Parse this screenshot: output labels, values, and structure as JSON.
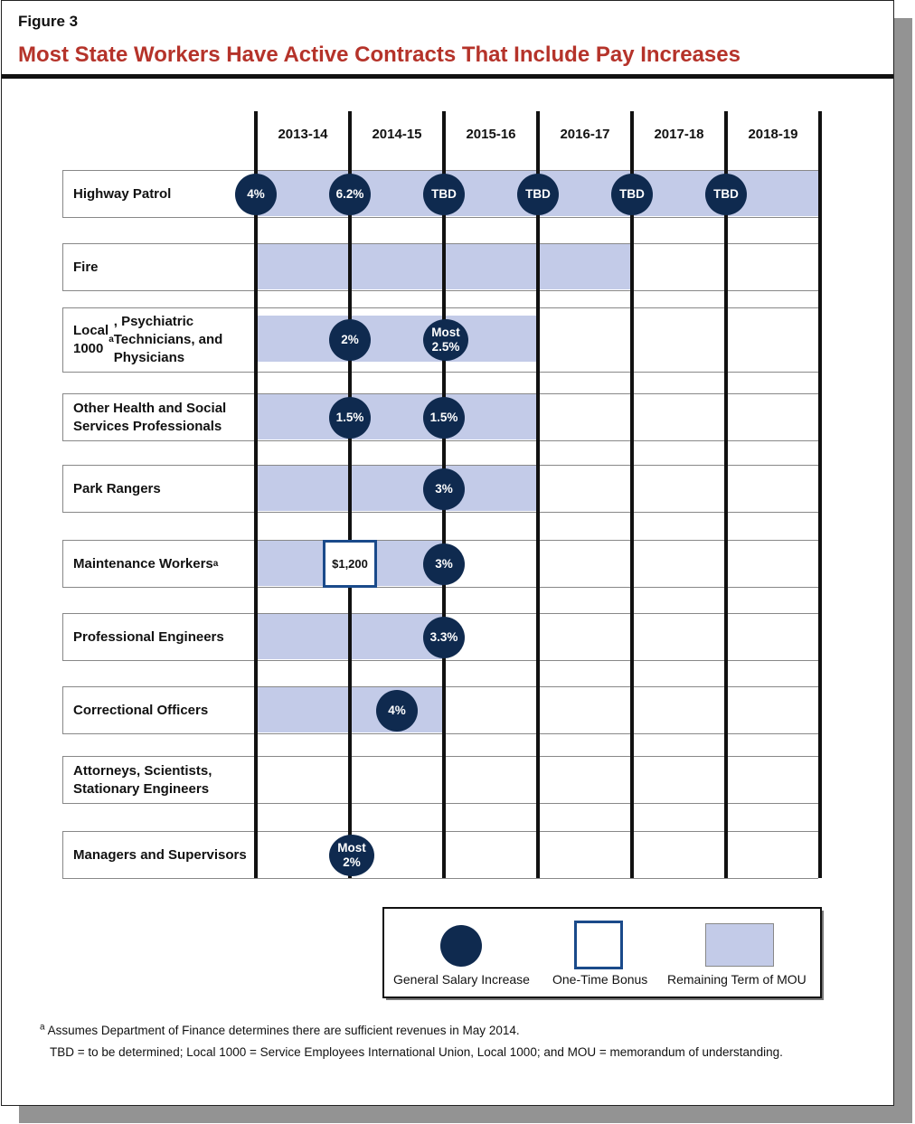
{
  "figure_label": "Figure 3",
  "title": "Most State Workers Have Active Contracts That Include Pay Increases",
  "colors": {
    "title": "#b5332a",
    "salary_increase": "#0f2a4f",
    "bonus_border": "#1a4a8a",
    "mou_term": "#c3cbe8"
  },
  "columns": [
    "2013-14",
    "2014-15",
    "2015-16",
    "2016-17",
    "2017-18",
    "2018-19"
  ],
  "rows": [
    {
      "label": "Highway Patrol",
      "term_through": "2018-19",
      "increases": [
        {
          "date": "2013-07",
          "text": "4%"
        },
        {
          "date": "2014-07",
          "text": "6.2%"
        },
        {
          "date": "2015-07",
          "text": "TBD"
        },
        {
          "date": "2016-07",
          "text": "TBD"
        },
        {
          "date": "2017-07",
          "text": "TBD"
        },
        {
          "date": "2018-07",
          "text": "TBD"
        }
      ]
    },
    {
      "label": "Fire",
      "term_through": "2016-17",
      "increases": []
    },
    {
      "label": "Local 1000",
      "label_sup": "a",
      "label_rest": ", Psychiatric Technicians, and Physicians",
      "term_through": "2015-16",
      "increases": [
        {
          "date": "2014-07",
          "text": "2%"
        },
        {
          "date": "2015-07",
          "text": "Most 2.5%"
        }
      ]
    },
    {
      "label": "Other Health and Social Services Professionals",
      "term_through": "2015-16",
      "increases": [
        {
          "date": "2014-07",
          "text": "1.5%"
        },
        {
          "date": "2015-07",
          "text": "1.5%"
        }
      ]
    },
    {
      "label": "Park Rangers",
      "term_through": "2015-16",
      "increases": [
        {
          "date": "2015-07",
          "text": "3%"
        }
      ]
    },
    {
      "label": "Maintenance Workers",
      "label_sup": "a",
      "term_through": "2014-15",
      "increases": [
        {
          "date": "2015-07",
          "text": "3%"
        }
      ],
      "bonuses": [
        {
          "date": "2014-07",
          "text": "$1,200"
        }
      ]
    },
    {
      "label": "Professional Engineers",
      "term_through": "2014-15",
      "increases": [
        {
          "date": "2015-07",
          "text": "3.3%"
        }
      ]
    },
    {
      "label": "Correctional Officers",
      "term_through": "2014-15",
      "increases": [
        {
          "date": "2015-01",
          "text": "4%"
        }
      ]
    },
    {
      "label": "Attorneys, Scientists, Stationary Engineers",
      "term_through": null,
      "increases": []
    },
    {
      "label": "Managers and Supervisors",
      "term_through": null,
      "increases": [
        {
          "date": "2014-07",
          "text": "Most 2%"
        }
      ]
    }
  ],
  "legend": {
    "salary_increase": "General Salary Increase",
    "bonus": "One-Time Bonus",
    "mou_term": "Remaining Term of MOU"
  },
  "footnotes": {
    "a_marker": "a",
    "a": "Assumes Department of Finance determines there are sufficient revenues in May 2014.",
    "abbrev": "TBD = to be determined; Local 1000 = Service Employees International Union, Local 1000; and MOU = memorandum of understanding."
  }
}
